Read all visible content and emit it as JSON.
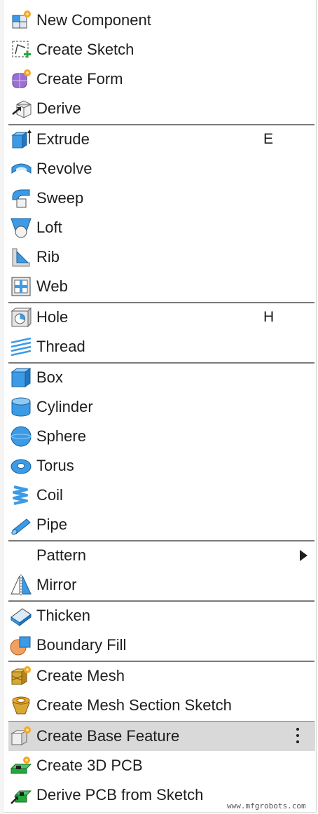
{
  "menu": {
    "items": [
      {
        "label": "New Component",
        "icon": "new-component-icon"
      },
      {
        "label": "Create Sketch",
        "icon": "create-sketch-icon"
      },
      {
        "label": "Create Form",
        "icon": "create-form-icon"
      },
      {
        "label": "Derive",
        "icon": "derive-icon"
      },
      {
        "label": "Extrude",
        "icon": "extrude-icon",
        "shortcut": "E"
      },
      {
        "label": "Revolve",
        "icon": "revolve-icon"
      },
      {
        "label": "Sweep",
        "icon": "sweep-icon"
      },
      {
        "label": "Loft",
        "icon": "loft-icon"
      },
      {
        "label": "Rib",
        "icon": "rib-icon"
      },
      {
        "label": "Web",
        "icon": "web-icon"
      },
      {
        "label": "Hole",
        "icon": "hole-icon",
        "shortcut": "H"
      },
      {
        "label": "Thread",
        "icon": "thread-icon"
      },
      {
        "label": "Box",
        "icon": "box-icon"
      },
      {
        "label": "Cylinder",
        "icon": "cylinder-icon"
      },
      {
        "label": "Sphere",
        "icon": "sphere-icon"
      },
      {
        "label": "Torus",
        "icon": "torus-icon"
      },
      {
        "label": "Coil",
        "icon": "coil-icon"
      },
      {
        "label": "Pipe",
        "icon": "pipe-icon"
      },
      {
        "label": "Pattern",
        "icon": "",
        "submenu": true
      },
      {
        "label": "Mirror",
        "icon": "mirror-icon"
      },
      {
        "label": "Thicken",
        "icon": "thicken-icon"
      },
      {
        "label": "Boundary Fill",
        "icon": "boundary-fill-icon"
      },
      {
        "label": "Create Mesh",
        "icon": "create-mesh-icon"
      },
      {
        "label": "Create Mesh Section Sketch",
        "icon": "create-mesh-section-sketch-icon"
      },
      {
        "label": "Create Base Feature",
        "icon": "create-base-feature-icon",
        "highlighted": true,
        "more_options": true
      },
      {
        "label": "Create 3D PCB",
        "icon": "create-3d-pcb-icon"
      },
      {
        "label": "Derive PCB from Sketch",
        "icon": "derive-pcb-from-sketch-icon"
      }
    ]
  },
  "watermark": "www.mfgrobots.com",
  "colors": {
    "icon_blue": "#3b9be6",
    "icon_orange": "#f5a623",
    "icon_purple": "#9b6fd6",
    "highlight": "#d9d9d9",
    "separator": "#7a7a7a"
  }
}
